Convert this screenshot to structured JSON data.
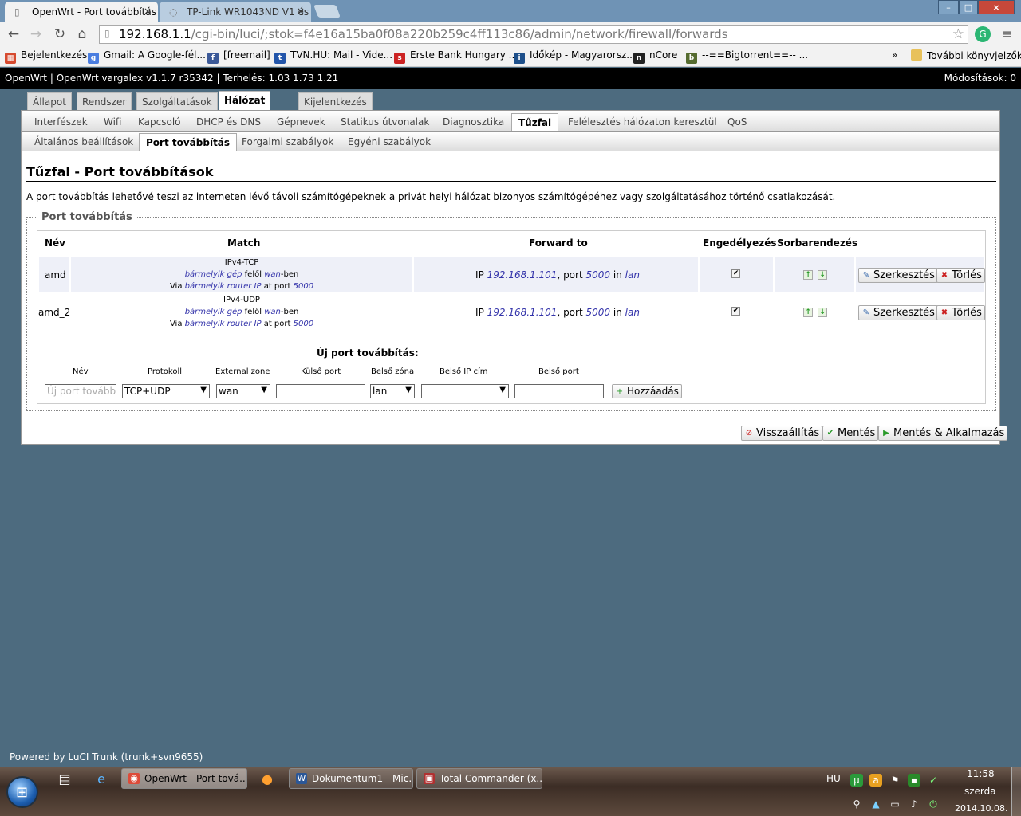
{
  "browser": {
    "tabs": [
      {
        "title": "OpenWrt - Port továbbítás",
        "close": "×"
      },
      {
        "title": "TP-Link WR1043ND V1 és",
        "close": "×"
      }
    ],
    "window_controls": {
      "minimize": "–",
      "maximize": "□",
      "close": "×"
    },
    "url_host": "192.168.1.1",
    "url_path": "/cgi-bin/luci/;stok=f4e16a15ba0f08a220b259c4ff113c86/admin/network/firewall/forwards",
    "bookmarks": [
      {
        "label": "Bejelentkezés",
        "icon": "apps-grid-icon",
        "color": "#d64a2f"
      },
      {
        "label": "Gmail: A Google-fél...",
        "icon": "google-icon",
        "color": "#4a7de0"
      },
      {
        "label": "[freemail]",
        "icon": "freemail-icon",
        "color": "#3b5998"
      },
      {
        "label": "TVN.HU: Mail - Vide...",
        "icon": "tvn-icon",
        "color": "#2255aa"
      },
      {
        "label": "Erste Bank Hungary ...",
        "icon": "erste-icon",
        "color": "#cc2222"
      },
      {
        "label": "Időkép - Magyarorsz...",
        "icon": "idokep-icon",
        "color": "#1d4f8a"
      },
      {
        "label": "nCore",
        "icon": "ncore-icon",
        "color": "#222222"
      },
      {
        "label": "--==Bigtorrent==-- ...",
        "icon": "bigtorrent-icon",
        "color": "#556b2f"
      }
    ],
    "more_bookmarks": "»",
    "other_bookmarks": "További könyvjelzők"
  },
  "luci": {
    "header_left": "OpenWrt | OpenWrt vargalex v1.1.7 r35342 | Terhelés: 1.03 1.73 1.21",
    "header_right": "Módosítások: 0",
    "top_menu": [
      "Állapot",
      "Rendszer",
      "Szolgáltatások",
      "Hálózat",
      "Kijelentkezés"
    ],
    "sub_menu": [
      "Interfészek",
      "Wifi",
      "Kapcsoló",
      "DHCP és DNS",
      "Gépnevek",
      "Statikus útvonalak",
      "Diagnosztika",
      "Tűzfal",
      "Felélesztés hálózaton keresztül",
      "QoS"
    ],
    "subsub_menu": [
      "Általános beállítások",
      "Port továbbítás",
      "Forgalmi szabályok",
      "Egyéni szabályok"
    ],
    "page_title": "Tűzfal - Port továbbítások",
    "page_desc": "A port továbbítás lehetővé teszi az interneten lévő távoli számítógépeknek a privát helyi hálózat bizonyos számítógépéhez vagy szolgáltatásához történő csatlakozását.",
    "section_legend": "Port továbbítás",
    "table_headers": [
      "Név",
      "Match",
      "Forward to",
      "Engedélyezés",
      "Sorbarendezés"
    ],
    "rows": [
      {
        "name": "amd",
        "match_proto": "IPv4-TCP",
        "match_src": "bármelyik gép",
        "match_from": "felől",
        "match_zone": "wan",
        "match_zone_suffix": "-ben",
        "match_via": "Via",
        "match_via_ip": "bármelyik router IP",
        "match_at_port": "at port",
        "match_port": "5000",
        "fwd_ip_label": "IP",
        "fwd_ip": "192.168.1.101",
        "fwd_port_label": ", port",
        "fwd_port": "5000",
        "fwd_in": "in",
        "fwd_zone": "lan",
        "enabled_mark": "✔"
      },
      {
        "name": "amd_2",
        "match_proto": "IPv4-UDP",
        "match_src": "bármelyik gép",
        "match_from": "felől",
        "match_zone": "wan",
        "match_zone_suffix": "-ben",
        "match_via": "Via",
        "match_via_ip": "bármelyik router IP",
        "match_at_port": "at port",
        "match_port": "5000",
        "fwd_ip_label": "IP",
        "fwd_ip": "192.168.1.101",
        "fwd_port_label": ", port",
        "fwd_port": "5000",
        "fwd_in": "in",
        "fwd_zone": "lan",
        "enabled_mark": "✔"
      }
    ],
    "edit_label": "Szerkesztés",
    "delete_label": "Törlés",
    "new_title": "Új port továbbítás:",
    "new_headers": [
      "Név",
      "Protokoll",
      "External zone",
      "Külső port",
      "Belső zóna",
      "Belső IP cím",
      "Belső port"
    ],
    "new_fields": {
      "name_placeholder": "Új port továbbítás",
      "protocol": "TCP+UDP",
      "external_zone": "wan",
      "external_port": "",
      "internal_zone": "lan",
      "internal_ip": "",
      "internal_port": ""
    },
    "add_label": "Hozzáadás",
    "reset_label": "Visszaállítás",
    "save_label": "Mentés",
    "save_apply_label": "Mentés & Alkalmazás",
    "powered_by": "Powered by LuCI Trunk (trunk+svn9655)"
  },
  "taskbar": {
    "buttons": [
      {
        "label": "OpenWrt - Port tová..."
      },
      {
        "label": "Dokumentum1 - Mic..."
      },
      {
        "label": "Total Commander (x..."
      }
    ],
    "language": "HU",
    "clock_time": "11:58",
    "clock_day": "szerda",
    "clock_date": "2014.10.08."
  },
  "colors": {
    "link": "#3333aa",
    "header_bg": "#000000",
    "desktop": "#4d6b7f"
  }
}
